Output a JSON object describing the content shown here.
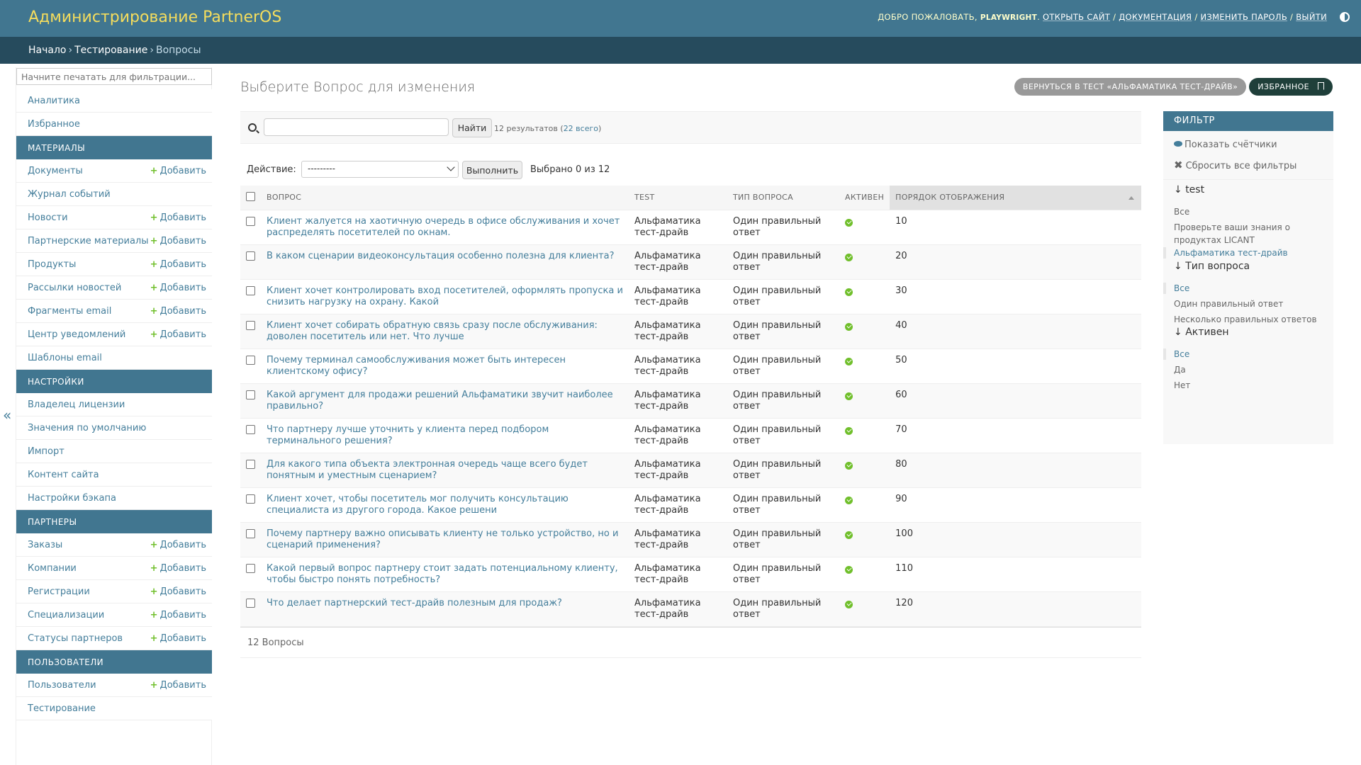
{
  "header": {
    "site_title": "Администрирование PartnerOS",
    "welcome": "Добро пожаловать,",
    "username": "playwright",
    "links": [
      "Открыть сайт",
      "Документация",
      "Изменить пароль",
      "Выйти"
    ]
  },
  "breadcrumbs": [
    "Начало",
    "Тестирование",
    "Вопросы"
  ],
  "sidebar": {
    "filter_placeholder": "Начните печатать для фильтрации...",
    "collapse_label": "«",
    "add_label": "Добавить",
    "rows": [
      {
        "label": "Аналитика",
        "type": "item",
        "add": false
      },
      {
        "label": "Избранное",
        "type": "item",
        "add": false
      },
      {
        "label": "Материалы",
        "type": "head"
      },
      {
        "label": "Документы",
        "type": "item",
        "add": true
      },
      {
        "label": "Журнал событий",
        "type": "item",
        "add": false
      },
      {
        "label": "Новости",
        "type": "item",
        "add": true
      },
      {
        "label": "Партнерские материалы",
        "type": "item",
        "add": true
      },
      {
        "label": "Продукты",
        "type": "item",
        "add": true
      },
      {
        "label": "Рассылки новостей",
        "type": "item",
        "add": true
      },
      {
        "label": "Фрагменты email",
        "type": "item",
        "add": true
      },
      {
        "label": "Центр уведомлений",
        "type": "item",
        "add": true
      },
      {
        "label": "Шаблоны email",
        "type": "item",
        "add": false
      },
      {
        "label": "Настройки",
        "type": "head"
      },
      {
        "label": "Владелец лицензии",
        "type": "item",
        "add": false
      },
      {
        "label": "Значения по умолчанию",
        "type": "item",
        "add": false
      },
      {
        "label": "Импорт",
        "type": "item",
        "add": false
      },
      {
        "label": "Контент сайта",
        "type": "item",
        "add": false
      },
      {
        "label": "Настройки бэкапа",
        "type": "item",
        "add": false
      },
      {
        "label": "Партнеры",
        "type": "head"
      },
      {
        "label": "Заказы",
        "type": "item",
        "add": true
      },
      {
        "label": "Компании",
        "type": "item",
        "add": true
      },
      {
        "label": "Регистрации",
        "type": "item",
        "add": true
      },
      {
        "label": "Специализации",
        "type": "item",
        "add": true
      },
      {
        "label": "Статусы партнеров",
        "type": "item",
        "add": true
      },
      {
        "label": "Пользователи",
        "type": "head"
      },
      {
        "label": "Пользователи",
        "type": "item",
        "add": true
      },
      {
        "label": "Тестирование",
        "type": "item",
        "add": false
      }
    ]
  },
  "content": {
    "title": "Выберите Вопрос для изменения",
    "back_button": "Вернуться в тест «Альфаматика тест-драйв»",
    "favorite_button": "Избранное",
    "search_button": "Найти",
    "result_count": "12 результатов",
    "total_link": "22 всего",
    "action_label": "Действие:",
    "action_selected": "---------",
    "action_go": "Выполнить",
    "action_counter": "Выбрано 0 из 12",
    "paginator": "12 Вопросы"
  },
  "table": {
    "columns": [
      "Вопрос",
      "Test",
      "Тип вопроса",
      "Активен",
      "Порядок отображения"
    ],
    "rows": [
      {
        "question": "Клиент жалуется на хаотичную очередь в офисе обслуживания и хочет распределять посетителей по окнам.",
        "test": "Альфаматика тест-драйв",
        "type": "Один правильный ответ",
        "active": true,
        "order": "10"
      },
      {
        "question": "В каком сценарии видеоконсультация особенно полезна для клиента?",
        "test": "Альфаматика тест-драйв",
        "type": "Один правильный ответ",
        "active": true,
        "order": "20"
      },
      {
        "question": "Клиент хочет контролировать вход посетителей, оформлять пропуска и снизить нагрузку на охрану. Какой",
        "test": "Альфаматика тест-драйв",
        "type": "Один правильный ответ",
        "active": true,
        "order": "30"
      },
      {
        "question": "Клиент хочет собирать обратную связь сразу после обслуживания: доволен посетитель или нет. Что лучше",
        "test": "Альфаматика тест-драйв",
        "type": "Один правильный ответ",
        "active": true,
        "order": "40"
      },
      {
        "question": "Почему терминал самообслуживания может быть интересен клиентскому офису?",
        "test": "Альфаматика тест-драйв",
        "type": "Один правильный ответ",
        "active": true,
        "order": "50"
      },
      {
        "question": "Какой аргумент для продажи решений Альфаматики звучит наиболее правильно?",
        "test": "Альфаматика тест-драйв",
        "type": "Один правильный ответ",
        "active": true,
        "order": "60"
      },
      {
        "question": "Что партнеру лучше уточнить у клиента перед подбором терминального решения?",
        "test": "Альфаматика тест-драйв",
        "type": "Один правильный ответ",
        "active": true,
        "order": "70"
      },
      {
        "question": "Для какого типа объекта электронная очередь чаще всего будет понятным и уместным сценарием?",
        "test": "Альфаматика тест-драйв",
        "type": "Один правильный ответ",
        "active": true,
        "order": "80"
      },
      {
        "question": "Клиент хочет, чтобы посетитель мог получить консультацию специалиста из другого города. Какое решени",
        "test": "Альфаматика тест-драйв",
        "type": "Один правильный ответ",
        "active": true,
        "order": "90"
      },
      {
        "question": "Почему партнеру важно описывать клиенту не только устройство, но и сценарий применения?",
        "test": "Альфаматика тест-драйв",
        "type": "Один правильный ответ",
        "active": true,
        "order": "100"
      },
      {
        "question": "Какой первый вопрос партнеру стоит задать потенциальному клиенту, чтобы быстро понять потребность?",
        "test": "Альфаматика тест-драйв",
        "type": "Один правильный ответ",
        "active": true,
        "order": "110"
      },
      {
        "question": "Что делает партнерский тест-драйв полезным для продаж?",
        "test": "Альфаматика тест-драйв",
        "type": "Один правильный ответ",
        "active": true,
        "order": "120"
      }
    ]
  },
  "filter": {
    "title": "Фильтр",
    "show_counts": "Показать счётчики",
    "reset_all": "Сбросить все фильтры",
    "groups": [
      {
        "title": "test",
        "options": [
          "Все",
          "Проверьте ваши знания о продуктах LICANT",
          "Альфаматика тест-драйв"
        ],
        "selected": 2
      },
      {
        "title": "Тип вопроса",
        "options": [
          "Все",
          "Один правильный ответ",
          "Несколько правильных ответов"
        ],
        "selected": 0
      },
      {
        "title": "Активен",
        "options": [
          "Все",
          "Да",
          "Нет"
        ],
        "selected": 0
      }
    ]
  },
  "colors": {
    "header": "#417690",
    "breadcrumbs": "#264b5d",
    "title": "#f5dd5d",
    "link": "#447e9b",
    "ok": "#70bf2b"
  }
}
